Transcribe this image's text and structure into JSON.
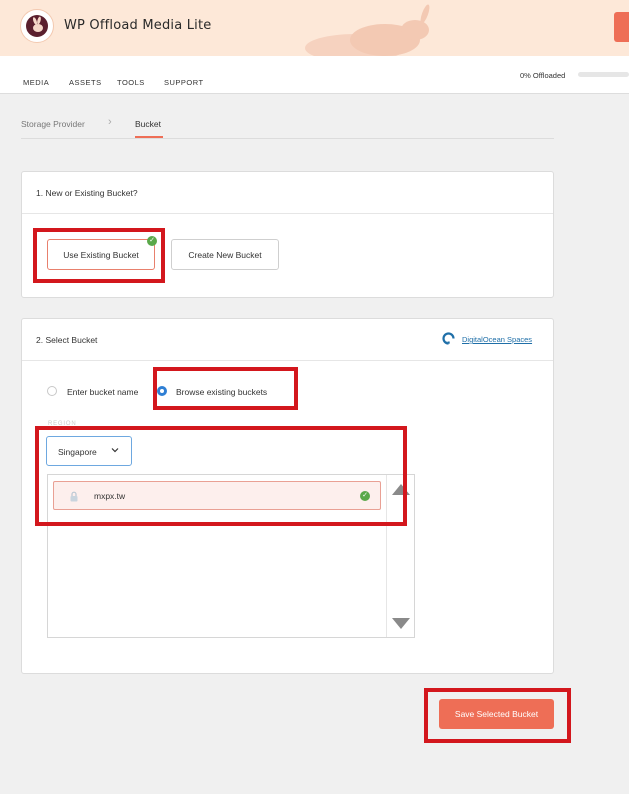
{
  "app": {
    "title": "WP Offload Media Lite"
  },
  "nav": {
    "items": [
      {
        "label": "MEDIA"
      },
      {
        "label": "ASSETS"
      },
      {
        "label": "TOOLS"
      },
      {
        "label": "SUPPORT"
      }
    ],
    "offload_status": "0% Offloaded",
    "offload_progress": 0
  },
  "breadcrumb": {
    "items": [
      {
        "label": "Storage Provider"
      },
      {
        "label": "Bucket",
        "active": true
      }
    ]
  },
  "section1": {
    "title": "1. New or Existing Bucket?",
    "use_existing_label": "Use Existing Bucket",
    "create_new_label": "Create New Bucket",
    "selected": "use_existing"
  },
  "section2": {
    "title": "2. Select Bucket",
    "provider_link": "DigitalOcean Spaces",
    "options": {
      "enter_name": "Enter bucket name",
      "browse": "Browse existing buckets"
    },
    "selected_option": "browse",
    "region_label": "REGION",
    "region_value": "Singapore",
    "buckets": [
      {
        "name": "mxpx.tw",
        "selected": true
      }
    ]
  },
  "save_label": "Save Selected Bucket",
  "colors": {
    "accent": "#ee6e56",
    "header_bg": "#fde8d8",
    "highlight_box": "#d3171d",
    "radio_active": "#2f7fd4",
    "check_green": "#5aa84a",
    "link": "#1f6fa8"
  }
}
